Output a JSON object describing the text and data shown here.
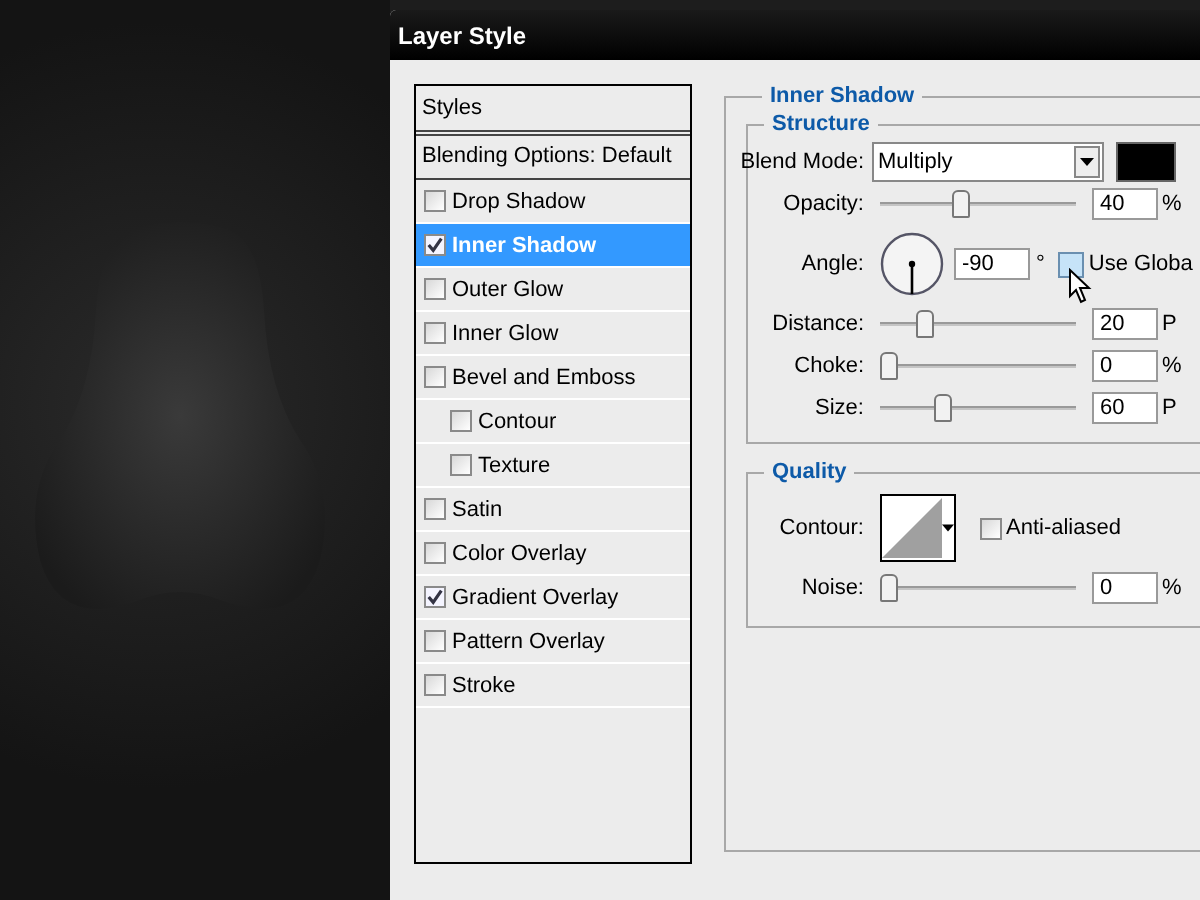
{
  "window": {
    "title": "Layer Style"
  },
  "styles_panel": {
    "header": "Styles",
    "blending_options": "Blending Options: Default",
    "items": [
      {
        "label": "Drop Shadow",
        "checked": false,
        "selected": false
      },
      {
        "label": "Inner Shadow",
        "checked": true,
        "selected": true
      },
      {
        "label": "Outer Glow",
        "checked": false,
        "selected": false
      },
      {
        "label": "Inner Glow",
        "checked": false,
        "selected": false
      },
      {
        "label": "Bevel and Emboss",
        "checked": false,
        "selected": false,
        "children": [
          {
            "label": "Contour",
            "checked": false,
            "selected": false
          },
          {
            "label": "Texture",
            "checked": false,
            "selected": false
          }
        ]
      },
      {
        "label": "Satin",
        "checked": false,
        "selected": false
      },
      {
        "label": "Color Overlay",
        "checked": false,
        "selected": false
      },
      {
        "label": "Gradient Overlay",
        "checked": true,
        "selected": false
      },
      {
        "label": "Pattern Overlay",
        "checked": false,
        "selected": false
      },
      {
        "label": "Stroke",
        "checked": false,
        "selected": false
      }
    ]
  },
  "inner_shadow": {
    "title": "Inner Shadow",
    "structure": {
      "title": "Structure",
      "blend_mode": {
        "label": "Blend Mode:",
        "value": "Multiply"
      },
      "opacity": {
        "label": "Opacity:",
        "level": 0.4,
        "value": "40",
        "unit": "%"
      },
      "angle": {
        "label": "Angle:",
        "value": "-90",
        "unit": "°",
        "use_global_light": {
          "label": "Use Globa",
          "checked": false
        }
      },
      "distance": {
        "label": "Distance:",
        "level": 0.2,
        "value": "20",
        "unit": "P"
      },
      "choke": {
        "label": "Choke:",
        "level": 0,
        "value": "0",
        "unit": "%"
      },
      "size": {
        "label": "Size:",
        "level": 0.3,
        "value": "60",
        "unit": "P"
      }
    },
    "quality": {
      "title": "Quality",
      "contour": {
        "label": "Contour:",
        "anti_aliased": {
          "label": "Anti-aliased",
          "checked": false
        }
      },
      "noise": {
        "label": "Noise:",
        "level": 0,
        "value": "0",
        "unit": "%"
      }
    }
  }
}
